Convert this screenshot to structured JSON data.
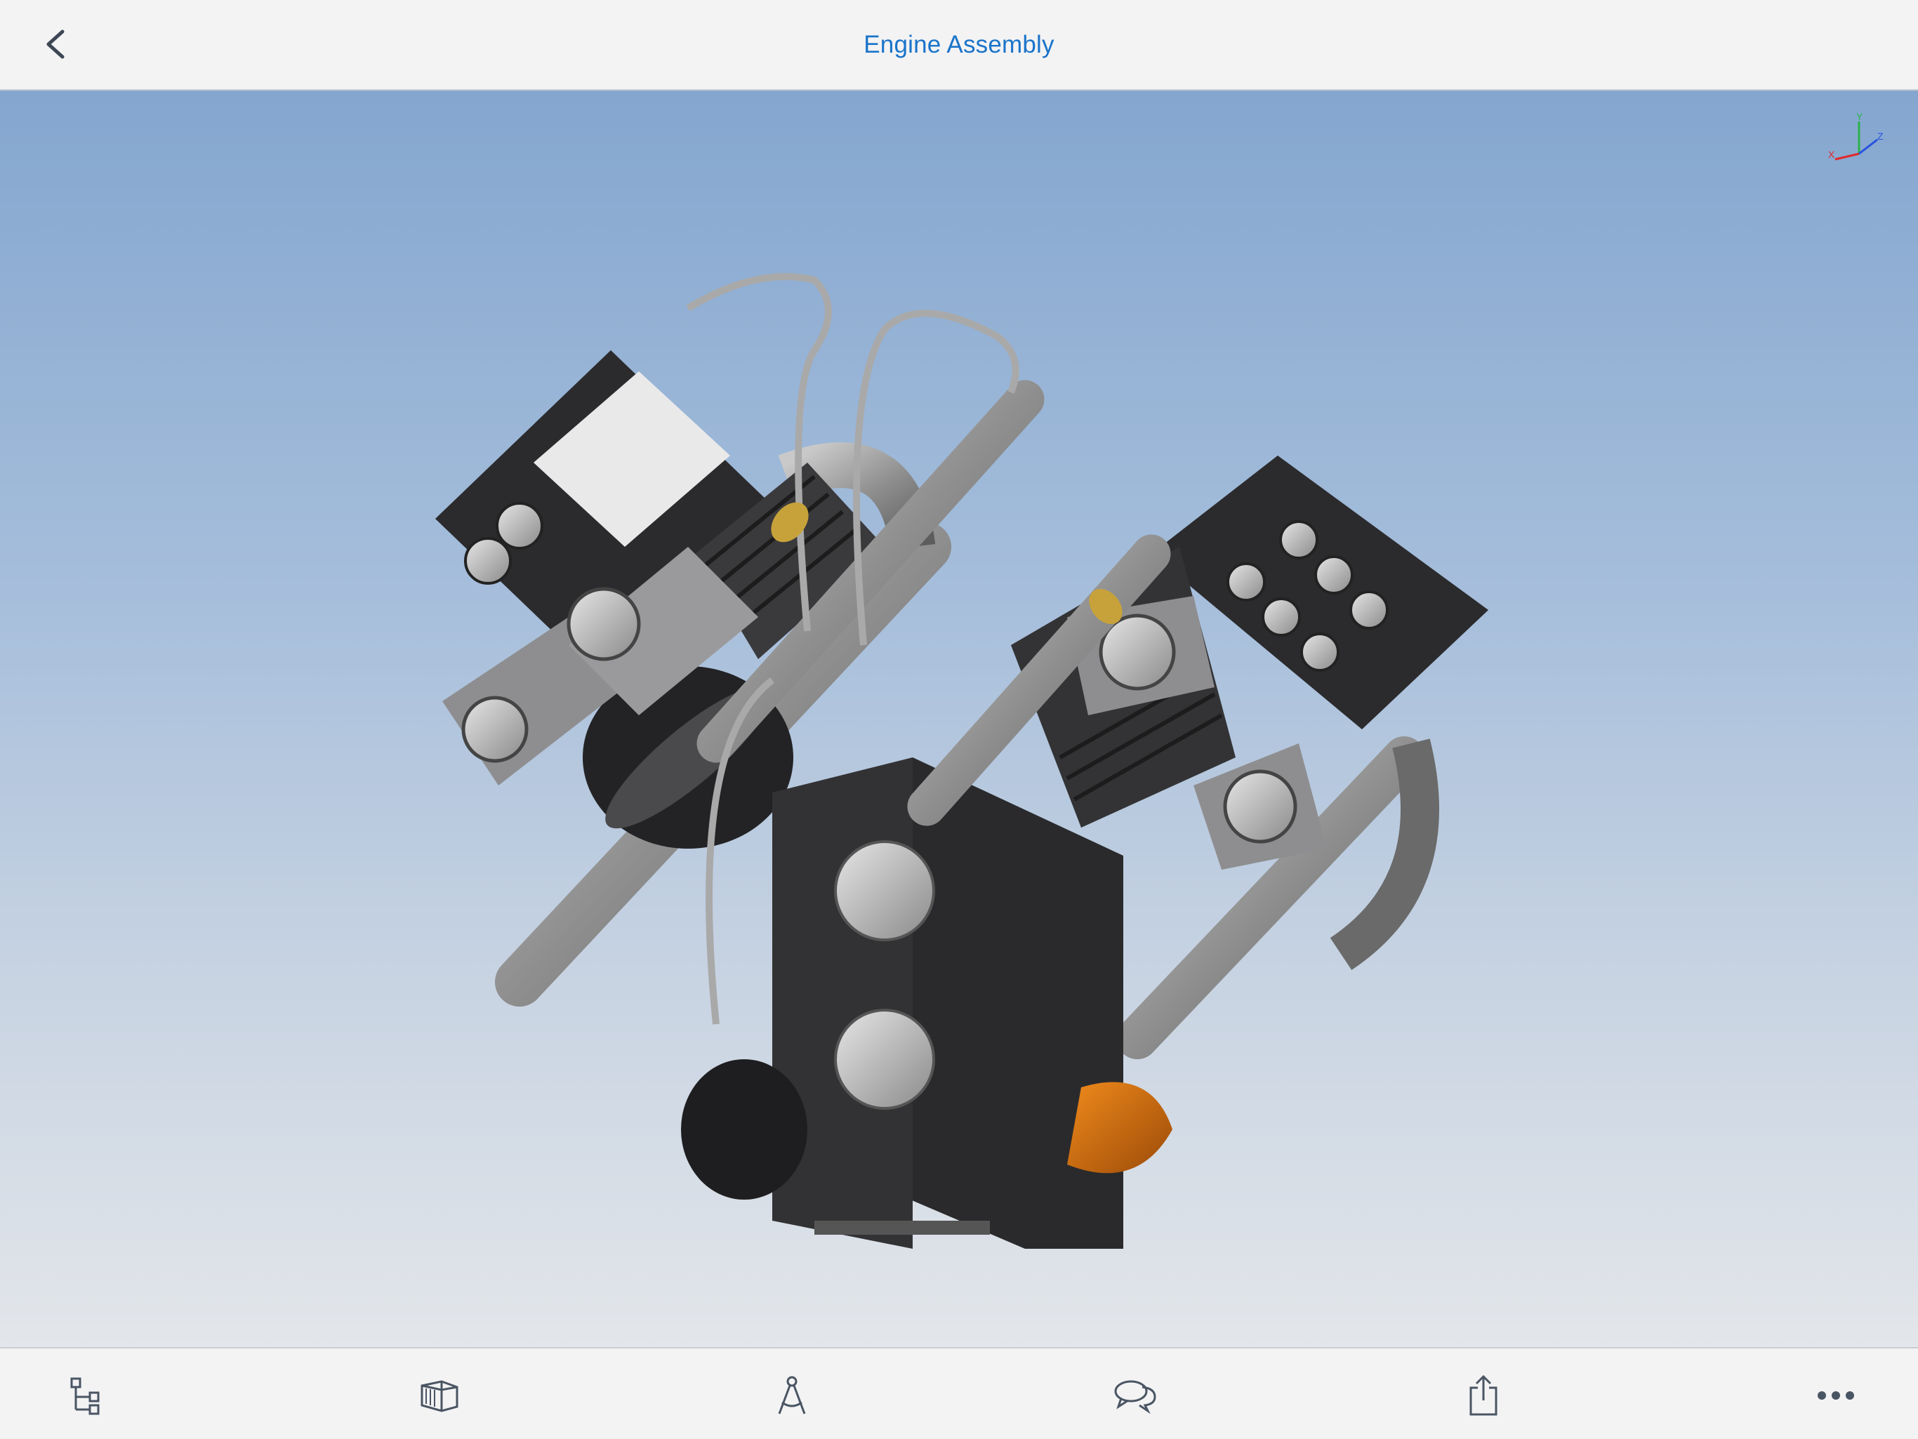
{
  "header": {
    "title": "Engine Assembly",
    "back_icon": "chevron-left-icon"
  },
  "viewport": {
    "model": "engine-assembly-3d-model",
    "triad_labels": {
      "x": "X",
      "y": "Y",
      "z": "Z"
    },
    "triad_colors": {
      "x": "#e02a2a",
      "y": "#2bb24a",
      "z": "#2a55e0"
    }
  },
  "toolbar": {
    "items": [
      {
        "icon": "feature-tree-icon"
      },
      {
        "icon": "section-view-icon"
      },
      {
        "icon": "measure-icon"
      },
      {
        "icon": "comments-icon"
      },
      {
        "icon": "share-icon"
      },
      {
        "icon": "more-icon"
      }
    ]
  },
  "colors": {
    "accent": "#1a74c9",
    "icon": "#4a5563"
  }
}
